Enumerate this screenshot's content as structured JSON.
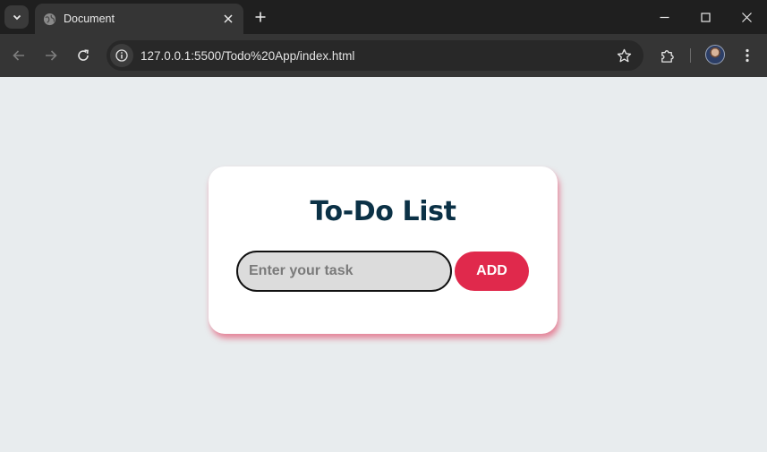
{
  "browser": {
    "tab_title": "Document",
    "url": "127.0.0.1:5500/Todo%20App/index.html",
    "icons": {
      "tab_search": "chevron-down-icon",
      "favicon": "globe-icon",
      "tab_close": "close-icon",
      "new_tab": "plus-icon",
      "minimize": "minimize-icon",
      "maximize": "maximize-icon",
      "close": "close-icon",
      "back": "arrow-left-icon",
      "forward": "arrow-right-icon",
      "reload": "reload-icon",
      "site_info": "info-icon",
      "bookmark": "star-icon",
      "extensions": "puzzle-icon",
      "profile": "avatar",
      "menu": "kebab-icon"
    }
  },
  "app": {
    "title": "To-Do List",
    "input_placeholder": "Enter your task",
    "input_value": "",
    "add_label": "ADD"
  },
  "colors": {
    "page_bg": "#e8ecee",
    "title": "#0b3146",
    "accent": "#e0294c",
    "input_bg": "#dcdcdc"
  }
}
